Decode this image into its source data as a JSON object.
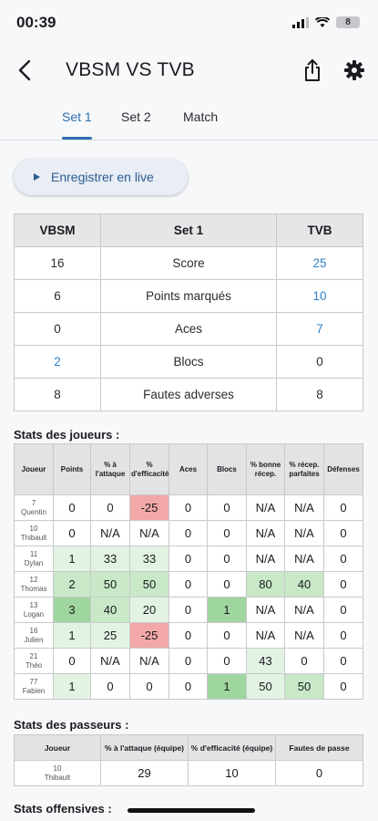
{
  "status": {
    "time": "00:39",
    "battery": "8"
  },
  "header": {
    "title": "VBSM VS TVB"
  },
  "tabs": [
    {
      "label": "Set 1"
    },
    {
      "label": "Set 2"
    },
    {
      "label": "Match"
    }
  ],
  "live_button": {
    "label": "Enregistrer en live"
  },
  "set_table": {
    "headers": [
      "VBSM",
      "Set 1",
      "TVB"
    ],
    "rows": [
      {
        "home": "16",
        "label": "Score",
        "away": "25"
      },
      {
        "home": "6",
        "label": "Points marqués",
        "away": "10"
      },
      {
        "home": "0",
        "label": "Aces",
        "away": "7"
      },
      {
        "home": "2",
        "label": "Blocs",
        "away": "0"
      },
      {
        "home": "8",
        "label": "Fautes adverses",
        "away": "8"
      }
    ]
  },
  "players_section": {
    "title": "Stats des joueurs :",
    "headers": [
      "Joueur",
      "Points",
      "% à l'attaque",
      "% d'efficacité",
      "Aces",
      "Blocs",
      "% bonne récep.",
      "% récep. parfaites",
      "Défenses"
    ],
    "rows": [
      {
        "number": "7",
        "name": "Quentin",
        "cells": [
          "0",
          "0",
          "-25",
          "0",
          "0",
          "N/A",
          "N/A",
          "0"
        ]
      },
      {
        "number": "10",
        "name": "Thibault",
        "cells": [
          "0",
          "N/A",
          "N/A",
          "0",
          "0",
          "N/A",
          "N/A",
          "0"
        ]
      },
      {
        "number": "11",
        "name": "Dylan",
        "cells": [
          "1",
          "33",
          "33",
          "0",
          "0",
          "N/A",
          "N/A",
          "0"
        ]
      },
      {
        "number": "12",
        "name": "Thomas",
        "cells": [
          "2",
          "50",
          "50",
          "0",
          "0",
          "80",
          "40",
          "0"
        ]
      },
      {
        "number": "13",
        "name": "Logan",
        "cells": [
          "3",
          "40",
          "20",
          "0",
          "1",
          "N/A",
          "N/A",
          "0"
        ]
      },
      {
        "number": "16",
        "name": "Julien",
        "cells": [
          "1",
          "25",
          "-25",
          "0",
          "0",
          "N/A",
          "N/A",
          "0"
        ]
      },
      {
        "number": "21",
        "name": "Théo",
        "cells": [
          "0",
          "N/A",
          "N/A",
          "0",
          "0",
          "43",
          "0",
          "0"
        ]
      },
      {
        "number": "77",
        "name": "Fabien",
        "cells": [
          "1",
          "0",
          "0",
          "0",
          "1",
          "50",
          "50",
          "0"
        ]
      }
    ]
  },
  "setters_section": {
    "title": "Stats des passeurs :",
    "headers": [
      "Joueur",
      "% à l'attaque (équipe)",
      "% d'efficacité (équipe)",
      "Fautes de passe"
    ],
    "rows": [
      {
        "number": "10",
        "name": "Thibault",
        "cells": [
          "29",
          "10",
          "0"
        ]
      }
    ]
  },
  "offensive_section": {
    "title": "Stats offensives :"
  },
  "colors": {
    "accent": "#2e6fb0",
    "positive": "#9fd59f",
    "negative": "#f2a8a8"
  }
}
